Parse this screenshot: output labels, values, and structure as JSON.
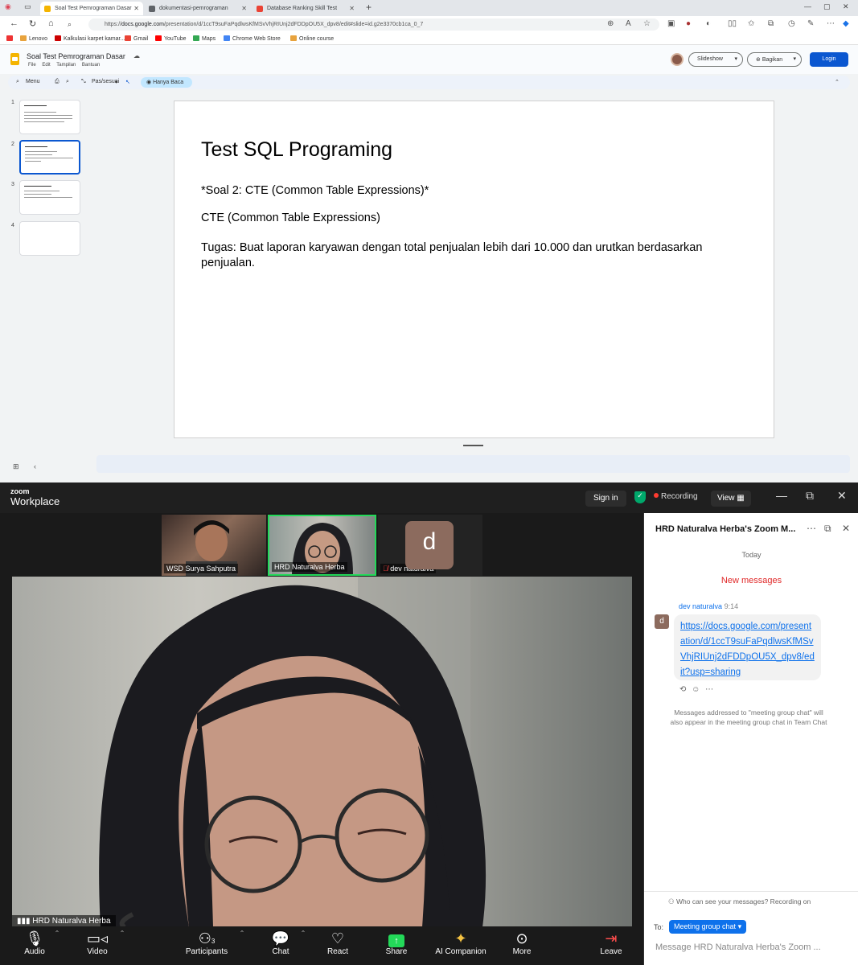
{
  "browser": {
    "tabs": [
      {
        "label": "Soal Test Pemrograman Dasar",
        "active": true,
        "color": "#f4b400"
      },
      {
        "label": "dokumentasi-pemrograman",
        "active": false,
        "color": "#5f6368"
      },
      {
        "label": "Database Ranking Skill Test",
        "active": false,
        "color": "#ea4335"
      }
    ],
    "url_prefix": "https://",
    "url_domain": "docs.google.com",
    "url_path": "/presentation/d/1ccT9suFaPqdlwsKfMSvVhjRIUnj2dFDDpOU5X_dpv8/edit#slide=id.g2e3370cb1ca_0_7",
    "bookmarks": [
      {
        "label": "Lenovo",
        "color": "#e8a33d"
      },
      {
        "label": "Kalkulasi karpet kamar...",
        "color": "#c00"
      },
      {
        "label": "Gmail",
        "color": "#ea4335"
      },
      {
        "label": "YouTube",
        "color": "#ff0000"
      },
      {
        "label": "Maps",
        "color": "#34a853"
      },
      {
        "label": "Chrome Web Store",
        "color": "#4285f4"
      },
      {
        "label": "Online course",
        "color": "#e8a33d"
      }
    ]
  },
  "docs": {
    "title": "Soal Test Pemrograman Dasar",
    "menu": "File  Edit  Tampilan  Bantuan",
    "slideshow_label": "Slideshow",
    "share_label": "Bagikan",
    "login_label": "Login",
    "toolbar": {
      "menus": "Menu",
      "zoom_label": "Pas/sesuai",
      "mode_label": "Hanya Baca"
    },
    "thumbnails": [
      {
        "num": "1"
      },
      {
        "num": "2"
      },
      {
        "num": "3"
      },
      {
        "num": "4"
      }
    ]
  },
  "slide": {
    "title": "Test SQL Programing",
    "line1": "*Soal 2: CTE (Common Table Expressions)*",
    "line2": "CTE (Common Table Expressions)",
    "line3": "Tugas: Buat laporan karyawan dengan total penjualan lebih dari 10.000 dan urutkan berdasarkan penjualan."
  },
  "zoom": {
    "logo_top": "zoom",
    "logo_bottom": "Workplace",
    "signin": "Sign in",
    "recording": "Recording",
    "view": "View",
    "participants": [
      {
        "name": "WSD Surya Sahputra"
      },
      {
        "name": "HRD Naturalva Herba"
      },
      {
        "name": "dev naturalva",
        "initial": "d"
      }
    ],
    "main_name": "HRD Naturalva Herba",
    "controls": [
      {
        "label": "Audio"
      },
      {
        "label": "Video"
      },
      {
        "label": "Participants",
        "count": "3"
      },
      {
        "label": "Chat"
      },
      {
        "label": "React"
      },
      {
        "label": "Share"
      },
      {
        "label": "AI Companion"
      },
      {
        "label": "More"
      },
      {
        "label": "Leave"
      }
    ],
    "chat": {
      "title": "HRD Naturalva Herba's Zoom M...",
      "today": "Today",
      "new_messages": "New messages",
      "sender": "dev naturalva",
      "time": "9:14",
      "avatar": "d",
      "message": "https://docs.google.com/presentation/d/1ccT9suFaPqdlwsKfMSvVhjRIUnj2dFDDpOU5X_dpv8/edit?usp=sharing",
      "note": "Messages addressed to \"meeting group chat\" will also appear in the meeting group chat in Team Chat",
      "who_can_see": "Who can see your messages? Recording on",
      "to_label": "To:",
      "to_value": "Meeting group chat",
      "input_placeholder": "Message HRD Naturalva Herba's Zoom ..."
    },
    "accent": "#0e71eb",
    "share_color": "#23d959"
  }
}
